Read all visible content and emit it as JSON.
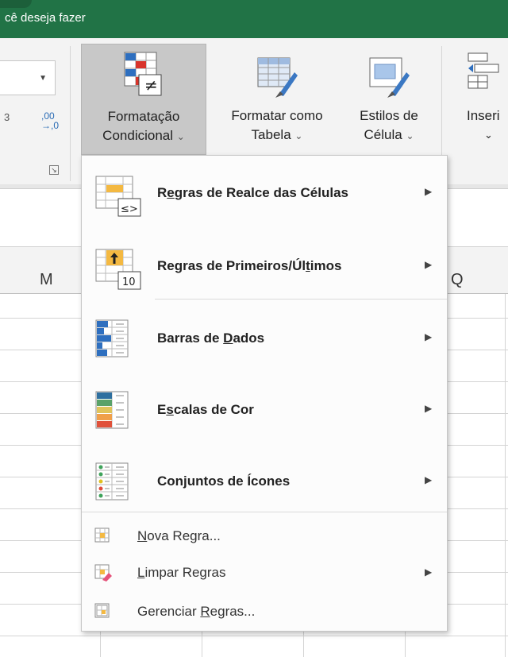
{
  "title_bar": {
    "tell_me_text": "cê deseja fazer",
    "accent_color": "#217346"
  },
  "ribbon": {
    "number_format_decimal": ",00",
    "number_format_decimal2": "→,0",
    "conditional_formatting": {
      "line1": "Formatação",
      "line2": "Condicional",
      "chevron": "⌄"
    },
    "format_as_table": {
      "line1": "Formatar como",
      "line2": "Tabela",
      "chevron": "⌄"
    },
    "cell_styles": {
      "line1": "Estilos de",
      "line2": "Célula",
      "chevron": "⌄"
    },
    "insert": {
      "line1": "Inseri",
      "chevron": "⌄"
    }
  },
  "columns": {
    "m": "M",
    "q": "Q"
  },
  "menu": {
    "highlight_rules": {
      "pre": "R",
      "accel": "e",
      "post": "gras de Realce das Células"
    },
    "top_bottom_rules": {
      "pre": "Regras de Primeiros/Úl",
      "accel": "t",
      "post": "imos"
    },
    "data_bars": {
      "pre": "Barras de ",
      "accel": "D",
      "post": "ados"
    },
    "color_scales": {
      "pre": "E",
      "accel": "s",
      "post": "calas de Cor"
    },
    "icon_sets": {
      "pre": "Con",
      "accel": "j",
      "post": "untos de Ícones"
    },
    "new_rule": {
      "pre": "",
      "accel": "N",
      "post": "ova Regra..."
    },
    "clear_rules": {
      "pre": "",
      "accel": "L",
      "post": "impar Regras"
    },
    "manage_rules": {
      "pre": "Gerenciar ",
      "accel": "R",
      "post": "egras..."
    },
    "submenu_arrow": "▶",
    "icon_label_10": "10"
  }
}
